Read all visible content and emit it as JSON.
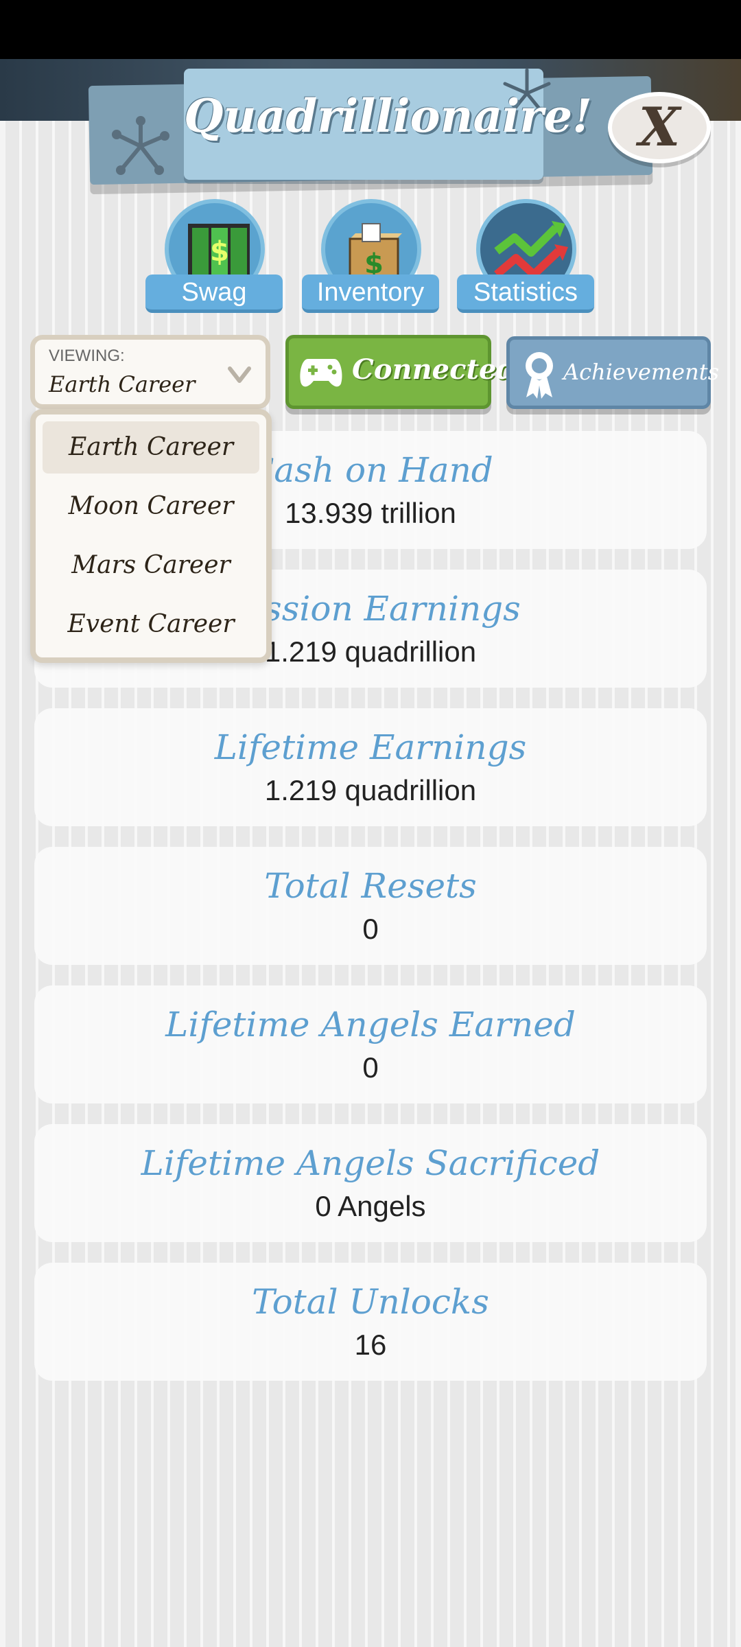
{
  "header": {
    "title": "Quadrillionaire!",
    "close_label": "X"
  },
  "tabs": [
    {
      "label": "Swag",
      "icon": "money-doors-icon"
    },
    {
      "label": "Inventory",
      "icon": "cash-box-icon"
    },
    {
      "label": "Statistics",
      "icon": "trend-arrows-icon"
    }
  ],
  "viewing": {
    "caption": "VIEWING:",
    "value": "Earth Career"
  },
  "buttons": {
    "connected": "Connected",
    "achievements": "Achievements"
  },
  "dropdown": {
    "options": [
      "Earth Career",
      "Moon Career",
      "Mars Career",
      "Event Career"
    ],
    "selected": "Earth Career"
  },
  "stats": [
    {
      "title": "Cash on Hand",
      "value": "13.939 trillion"
    },
    {
      "title": "Session Earnings",
      "value": "1.219 quadrillion"
    },
    {
      "title": "Lifetime Earnings",
      "value": "1.219 quadrillion"
    },
    {
      "title": "Total Resets",
      "value": "0"
    },
    {
      "title": "Lifetime Angels Earned",
      "value": "0"
    },
    {
      "title": "Lifetime Angels Sacrificed",
      "value": "0 Angels"
    },
    {
      "title": "Total Unlocks",
      "value": "16"
    }
  ],
  "colors": {
    "accent_blue": "#5d9fd0",
    "connected_green": "#7ab543",
    "achievements_blue": "#7ea5c4",
    "banner": "#a8cce0"
  }
}
